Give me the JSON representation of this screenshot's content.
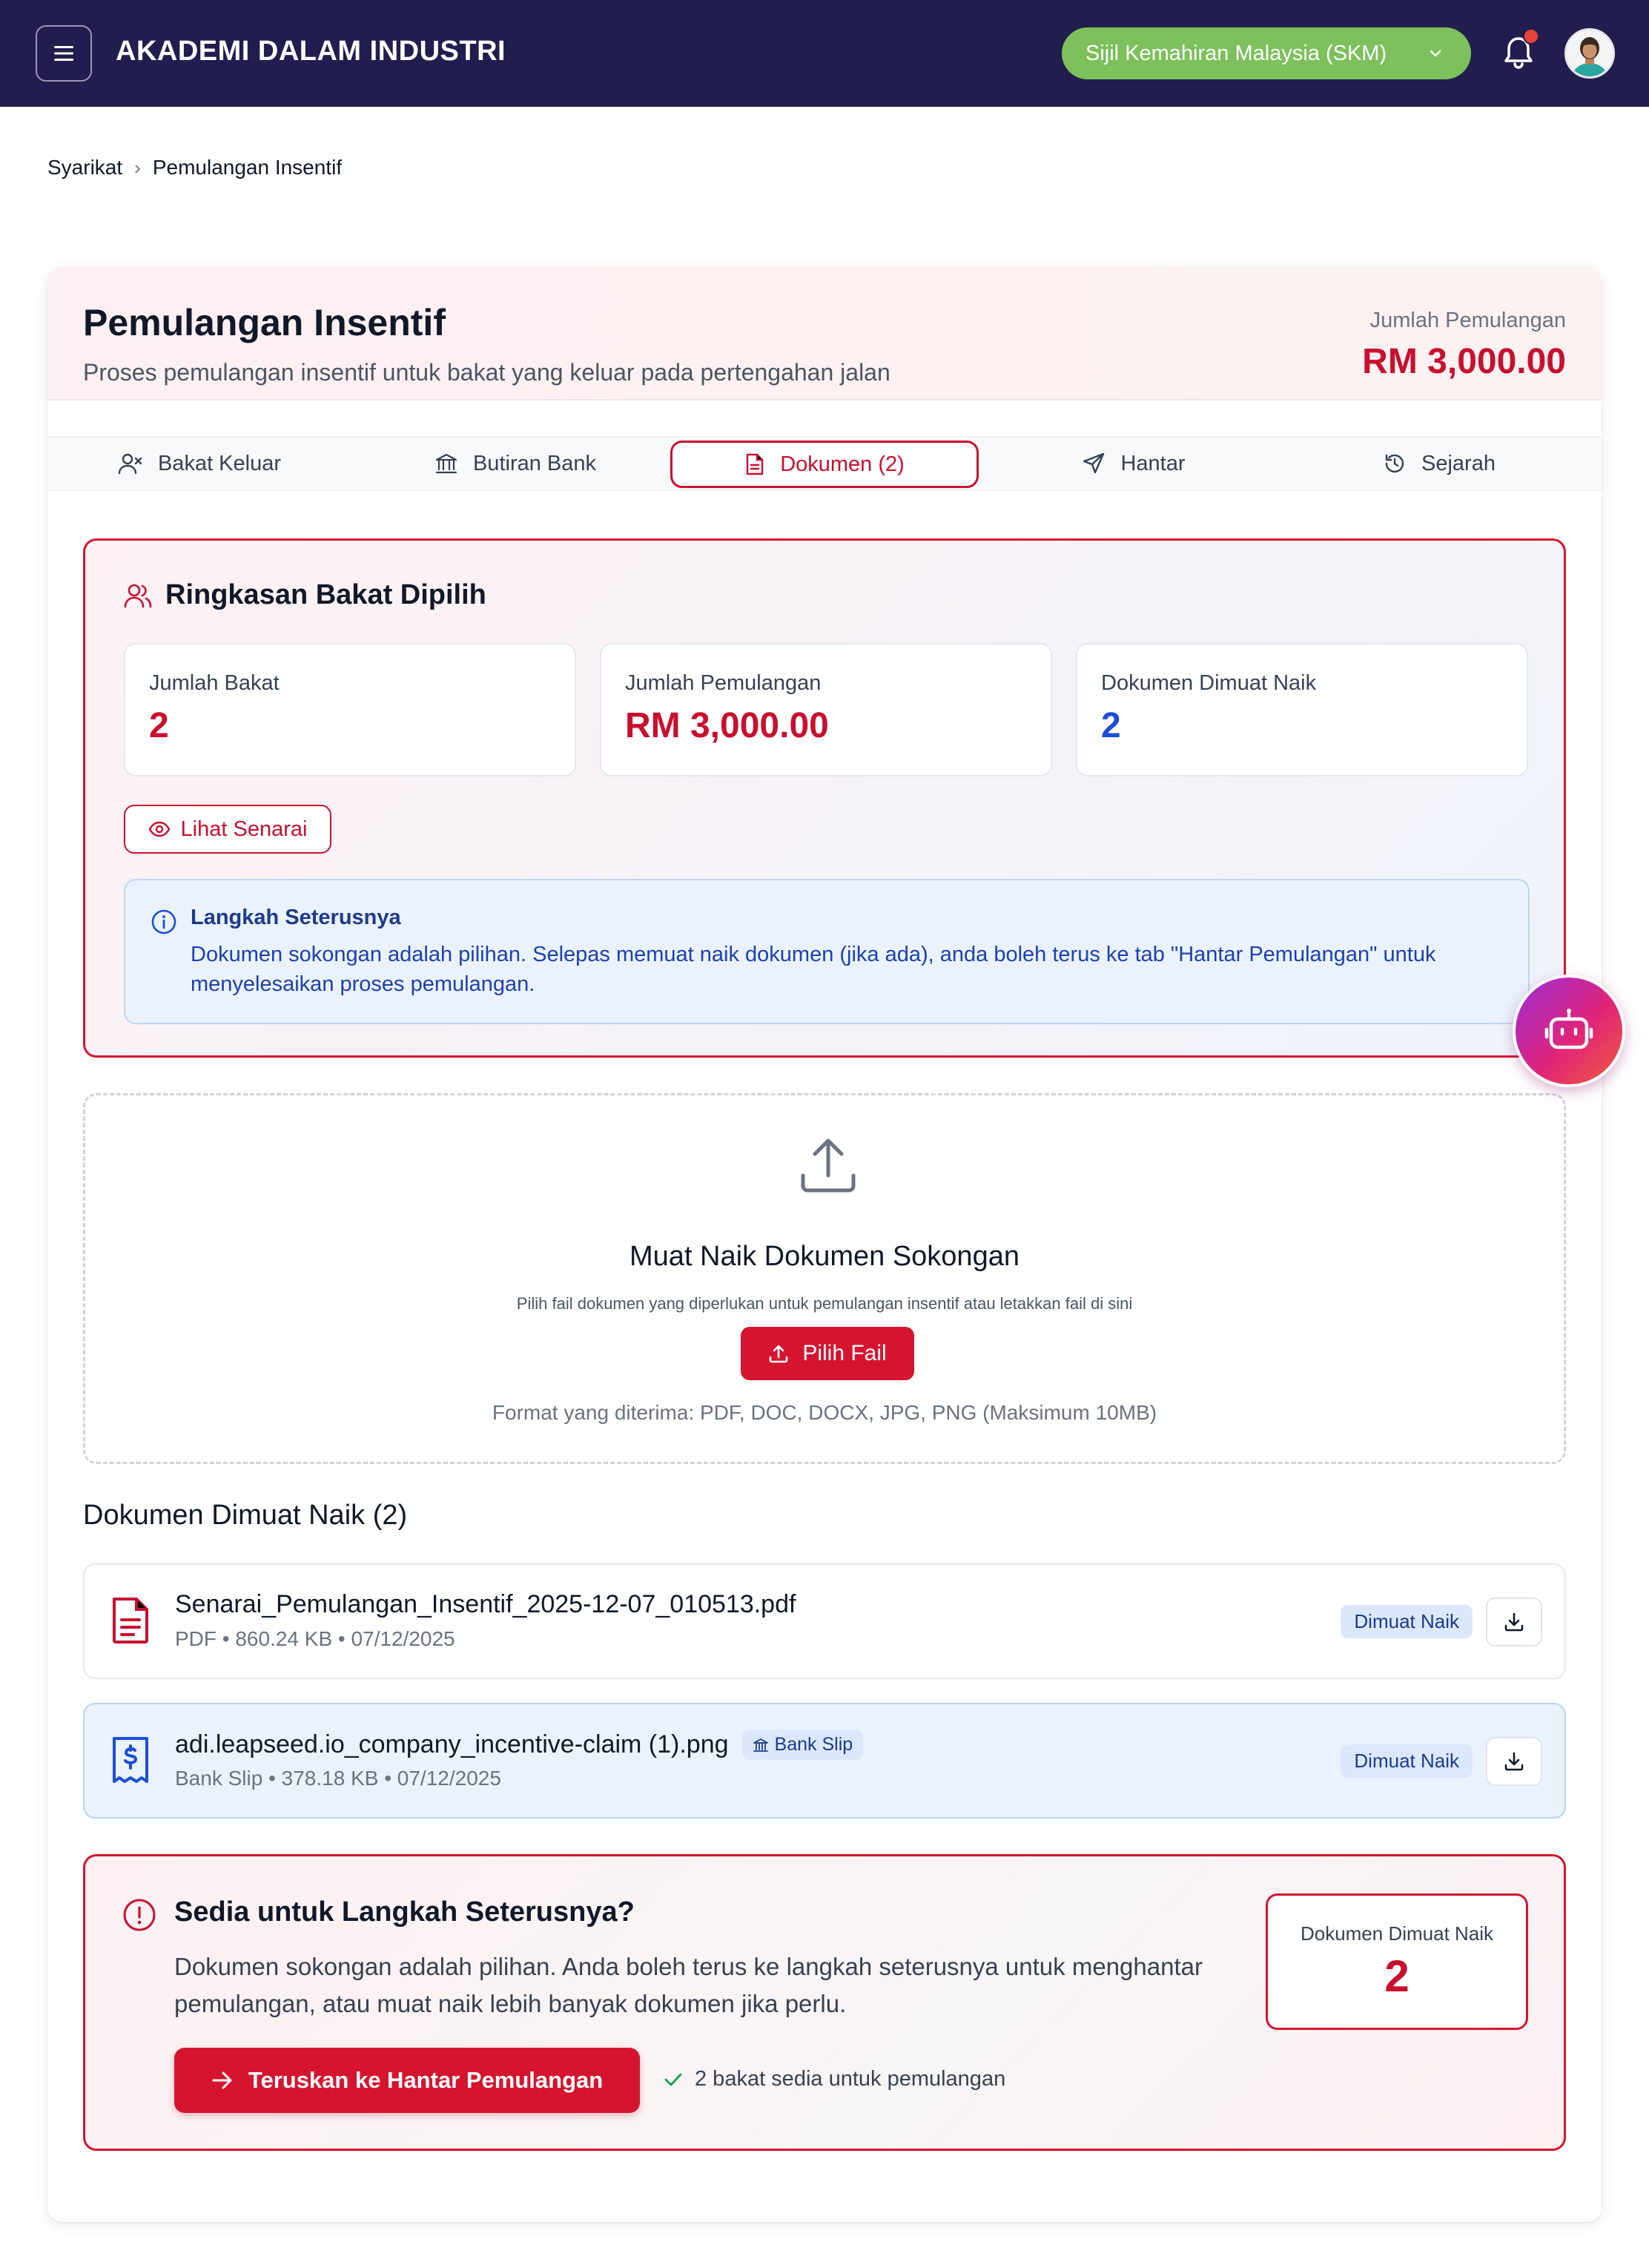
{
  "header": {
    "app_title": "AKADEMI DALAM INDUSTRI",
    "program_select": "Sijil Kemahiran Malaysia (SKM)",
    "accent_color": "#221d4f",
    "program_color": "#7dc05c",
    "has_notification": true
  },
  "breadcrumb": {
    "items": [
      "Syarikat",
      "Pemulangan Insentif"
    ],
    "separator": "›"
  },
  "page": {
    "title": "Pemulangan Insentif",
    "subtitle": "Proses pemulangan insentif untuk bakat yang keluar pada pertengahan jalan",
    "total_label": "Jumlah Pemulangan",
    "total_value": "RM 3,000.00",
    "brand_color": "#c8102e"
  },
  "tabs": [
    {
      "label": "Bakat Keluar",
      "icon": "user-x-icon",
      "active": false
    },
    {
      "label": "Butiran Bank",
      "icon": "bank-icon",
      "active": false
    },
    {
      "label": "Dokumen (2)",
      "icon": "document-icon",
      "active": true
    },
    {
      "label": "Hantar",
      "icon": "send-icon",
      "active": false
    },
    {
      "label": "Sejarah",
      "icon": "history-icon",
      "active": false
    }
  ],
  "summary": {
    "title": "Ringkasan Bakat Dipilih",
    "stats": [
      {
        "label": "Jumlah Bakat",
        "value": "2",
        "color": "#c8102e"
      },
      {
        "label": "Jumlah Pemulangan",
        "value": "RM 3,000.00",
        "color": "#c8102e"
      },
      {
        "label": "Dokumen Dimuat Naik",
        "value": "2",
        "color": "#1d4ed8"
      }
    ],
    "view_list_label": "Lihat Senarai",
    "info_title": "Langkah Seterusnya",
    "info_text": "Dokumen sokongan adalah pilihan. Selepas memuat naik dokumen (jika ada), anda boleh terus ke tab \"Hantar Pemulangan\" untuk menyelesaikan proses pemulangan."
  },
  "upload": {
    "title": "Muat Naik Dokumen Sokongan",
    "subtitle": "Pilih fail dokumen yang diperlukan untuk pemulangan insentif atau letakkan fail di sini",
    "button_label": "Pilih Fail",
    "formats": "Format yang diterima: PDF, DOC, DOCX, JPG, PNG (Maksimum 10MB)"
  },
  "documents": {
    "heading": "Dokumen Dimuat Naik (2)",
    "items": [
      {
        "name": "Senarai_Pemulangan_Insentif_2025-12-07_010513.pdf",
        "meta": "PDF • 860.24 KB • 07/12/2025",
        "tag": "",
        "status": "Dimuat Naik",
        "icon": "pdf-file-icon"
      },
      {
        "name": "adi.leapseed.io_company_incentive-claim (1).png",
        "meta": "Bank Slip • 378.18 KB • 07/12/2025",
        "tag": "Bank Slip",
        "status": "Dimuat Naik",
        "icon": "receipt-icon"
      }
    ]
  },
  "ready": {
    "title": "Sedia untuk Langkah Seterusnya?",
    "text": "Dokumen sokongan adalah pilihan. Anda boleh terus ke langkah seterusnya untuk menghantar pemulangan, atau muat naik lebih banyak dokumen jika perlu.",
    "button_label": "Teruskan ke Hantar Pemulangan",
    "note": "2 bakat sedia untuk pemulangan",
    "stat_label": "Dokumen Dimuat Naik",
    "stat_value": "2"
  }
}
